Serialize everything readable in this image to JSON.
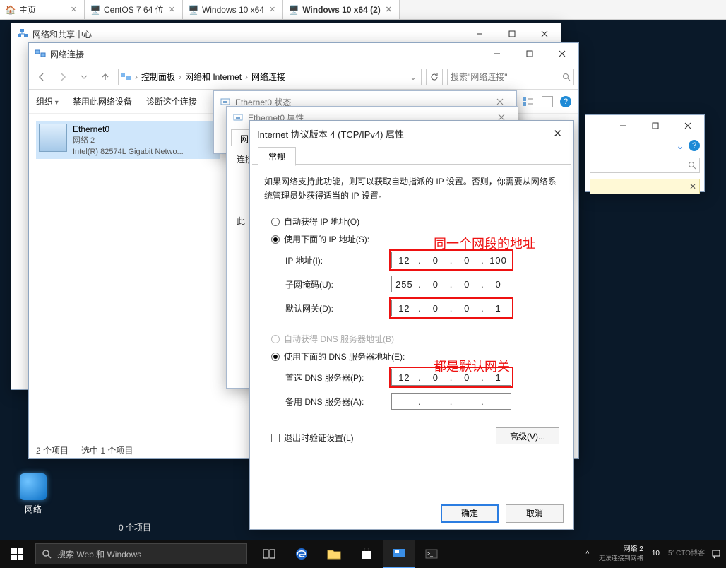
{
  "vm_tabs": [
    {
      "label": "主页",
      "icon": "home"
    },
    {
      "label": "CentOS 7 64 位",
      "icon": "vm"
    },
    {
      "label": "Windows 10 x64",
      "icon": "vm"
    },
    {
      "label": "Windows 10 x64 (2)",
      "icon": "vm",
      "selected": true
    }
  ],
  "win1": {
    "title": "网络和共享中心"
  },
  "win2": {
    "title": "网络连接",
    "breadcrumb": [
      "控制面板",
      "网络和 Internet",
      "网络连接"
    ],
    "search_placeholder": "搜索\"网络连接\"",
    "cmdbar": {
      "organize": "组织",
      "disable": "禁用此网络设备",
      "diagnose": "诊断这个连接"
    },
    "adapter": {
      "name": "Ethernet0",
      "net": "网络  2",
      "device": "Intel(R) 82574L Gigabit Netwo..."
    },
    "status": {
      "count": "2 个项目",
      "selected": "选中 1 个项目"
    }
  },
  "win3": {
    "title": "Ethernet0 状态"
  },
  "win4": {
    "title": "Ethernet0 属性",
    "tab": "网络",
    "connect_label": "连接时使用:",
    "item_prefix": "此"
  },
  "win5": {
    "title": "Internet 协议版本 4 (TCP/IPv4) 属性",
    "tab": "常规",
    "desc": "如果网络支持此功能，则可以获取自动指派的 IP 设置。否则，你需要从网络系统管理员处获得适当的 IP 设置。",
    "r_auto_ip": "自动获得 IP 地址(O)",
    "r_use_ip": "使用下面的 IP 地址(S):",
    "f_ip": "IP 地址(I):",
    "f_mask": "子网掩码(U):",
    "f_gw": "默认网关(D):",
    "r_auto_dns": "自动获得 DNS 服务器地址(B)",
    "r_use_dns": "使用下面的 DNS 服务器地址(E):",
    "f_dns1": "首选 DNS 服务器(P):",
    "f_dns2": "备用 DNS 服务器(A):",
    "chk_validate": "退出时验证设置(L)",
    "btn_adv": "高级(V)...",
    "btn_ok": "确定",
    "btn_cancel": "取消",
    "ip": [
      "12",
      "0",
      "0",
      "100"
    ],
    "mask": [
      "255",
      "0",
      "0",
      "0"
    ],
    "gw": [
      "12",
      "0",
      "0",
      "1"
    ],
    "dns1": [
      "12",
      "0",
      "0",
      "1"
    ],
    "dns2": [
      "",
      "",
      "",
      ""
    ],
    "anno1": "同一个网段的地址",
    "anno2": "都是默认网关"
  },
  "desktop_icon": "网络",
  "lone_status": "0 个项目",
  "taskbar": {
    "search_placeholder": "搜索 Web 和 Windows",
    "tray_net": "网络  2",
    "tray_net2": "无法连接到网络",
    "tray_time": "10",
    "watermark": "51CTO博客"
  }
}
